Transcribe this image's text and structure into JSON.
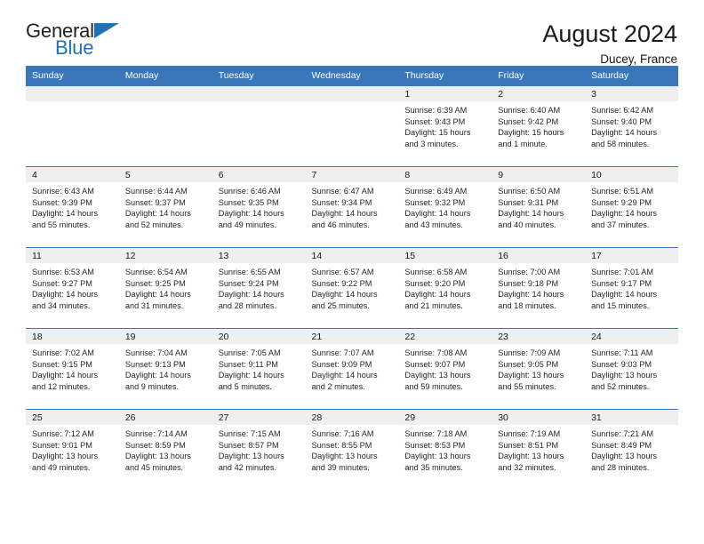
{
  "brand": {
    "name_part1": "General",
    "name_part2": "Blue",
    "triangle_color": "#1c72bb"
  },
  "header": {
    "title": "August 2024",
    "subtitle": "Ducey, France"
  },
  "colors": {
    "header_blue": "#3a76ba",
    "daynum_band": "#efefef",
    "text": "#1a1a1a"
  },
  "calendar": {
    "weekday_headers": [
      "Sunday",
      "Monday",
      "Tuesday",
      "Wednesday",
      "Thursday",
      "Friday",
      "Saturday"
    ],
    "labels": {
      "sunrise": "Sunrise:",
      "sunset": "Sunset:",
      "daylight": "Daylight:"
    },
    "weeks": [
      [
        {
          "day": "",
          "empty": true
        },
        {
          "day": "",
          "empty": true
        },
        {
          "day": "",
          "empty": true
        },
        {
          "day": "",
          "empty": true
        },
        {
          "day": "1",
          "sunrise": "Sunrise: 6:39 AM",
          "sunset": "Sunset: 9:43 PM",
          "daylight_1": "Daylight: 15 hours",
          "daylight_2": "and 3 minutes."
        },
        {
          "day": "2",
          "sunrise": "Sunrise: 6:40 AM",
          "sunset": "Sunset: 9:42 PM",
          "daylight_1": "Daylight: 15 hours",
          "daylight_2": "and 1 minute."
        },
        {
          "day": "3",
          "sunrise": "Sunrise: 6:42 AM",
          "sunset": "Sunset: 9:40 PM",
          "daylight_1": "Daylight: 14 hours",
          "daylight_2": "and 58 minutes."
        }
      ],
      [
        {
          "day": "4",
          "sunrise": "Sunrise: 6:43 AM",
          "sunset": "Sunset: 9:39 PM",
          "daylight_1": "Daylight: 14 hours",
          "daylight_2": "and 55 minutes."
        },
        {
          "day": "5",
          "sunrise": "Sunrise: 6:44 AM",
          "sunset": "Sunset: 9:37 PM",
          "daylight_1": "Daylight: 14 hours",
          "daylight_2": "and 52 minutes."
        },
        {
          "day": "6",
          "sunrise": "Sunrise: 6:46 AM",
          "sunset": "Sunset: 9:35 PM",
          "daylight_1": "Daylight: 14 hours",
          "daylight_2": "and 49 minutes."
        },
        {
          "day": "7",
          "sunrise": "Sunrise: 6:47 AM",
          "sunset": "Sunset: 9:34 PM",
          "daylight_1": "Daylight: 14 hours",
          "daylight_2": "and 46 minutes."
        },
        {
          "day": "8",
          "sunrise": "Sunrise: 6:49 AM",
          "sunset": "Sunset: 9:32 PM",
          "daylight_1": "Daylight: 14 hours",
          "daylight_2": "and 43 minutes."
        },
        {
          "day": "9",
          "sunrise": "Sunrise: 6:50 AM",
          "sunset": "Sunset: 9:31 PM",
          "daylight_1": "Daylight: 14 hours",
          "daylight_2": "and 40 minutes."
        },
        {
          "day": "10",
          "sunrise": "Sunrise: 6:51 AM",
          "sunset": "Sunset: 9:29 PM",
          "daylight_1": "Daylight: 14 hours",
          "daylight_2": "and 37 minutes."
        }
      ],
      [
        {
          "day": "11",
          "sunrise": "Sunrise: 6:53 AM",
          "sunset": "Sunset: 9:27 PM",
          "daylight_1": "Daylight: 14 hours",
          "daylight_2": "and 34 minutes."
        },
        {
          "day": "12",
          "sunrise": "Sunrise: 6:54 AM",
          "sunset": "Sunset: 9:25 PM",
          "daylight_1": "Daylight: 14 hours",
          "daylight_2": "and 31 minutes."
        },
        {
          "day": "13",
          "sunrise": "Sunrise: 6:55 AM",
          "sunset": "Sunset: 9:24 PM",
          "daylight_1": "Daylight: 14 hours",
          "daylight_2": "and 28 minutes."
        },
        {
          "day": "14",
          "sunrise": "Sunrise: 6:57 AM",
          "sunset": "Sunset: 9:22 PM",
          "daylight_1": "Daylight: 14 hours",
          "daylight_2": "and 25 minutes."
        },
        {
          "day": "15",
          "sunrise": "Sunrise: 6:58 AM",
          "sunset": "Sunset: 9:20 PM",
          "daylight_1": "Daylight: 14 hours",
          "daylight_2": "and 21 minutes."
        },
        {
          "day": "16",
          "sunrise": "Sunrise: 7:00 AM",
          "sunset": "Sunset: 9:18 PM",
          "daylight_1": "Daylight: 14 hours",
          "daylight_2": "and 18 minutes."
        },
        {
          "day": "17",
          "sunrise": "Sunrise: 7:01 AM",
          "sunset": "Sunset: 9:17 PM",
          "daylight_1": "Daylight: 14 hours",
          "daylight_2": "and 15 minutes."
        }
      ],
      [
        {
          "day": "18",
          "sunrise": "Sunrise: 7:02 AM",
          "sunset": "Sunset: 9:15 PM",
          "daylight_1": "Daylight: 14 hours",
          "daylight_2": "and 12 minutes."
        },
        {
          "day": "19",
          "sunrise": "Sunrise: 7:04 AM",
          "sunset": "Sunset: 9:13 PM",
          "daylight_1": "Daylight: 14 hours",
          "daylight_2": "and 9 minutes."
        },
        {
          "day": "20",
          "sunrise": "Sunrise: 7:05 AM",
          "sunset": "Sunset: 9:11 PM",
          "daylight_1": "Daylight: 14 hours",
          "daylight_2": "and 5 minutes."
        },
        {
          "day": "21",
          "sunrise": "Sunrise: 7:07 AM",
          "sunset": "Sunset: 9:09 PM",
          "daylight_1": "Daylight: 14 hours",
          "daylight_2": "and 2 minutes."
        },
        {
          "day": "22",
          "sunrise": "Sunrise: 7:08 AM",
          "sunset": "Sunset: 9:07 PM",
          "daylight_1": "Daylight: 13 hours",
          "daylight_2": "and 59 minutes."
        },
        {
          "day": "23",
          "sunrise": "Sunrise: 7:09 AM",
          "sunset": "Sunset: 9:05 PM",
          "daylight_1": "Daylight: 13 hours",
          "daylight_2": "and 55 minutes."
        },
        {
          "day": "24",
          "sunrise": "Sunrise: 7:11 AM",
          "sunset": "Sunset: 9:03 PM",
          "daylight_1": "Daylight: 13 hours",
          "daylight_2": "and 52 minutes."
        }
      ],
      [
        {
          "day": "25",
          "sunrise": "Sunrise: 7:12 AM",
          "sunset": "Sunset: 9:01 PM",
          "daylight_1": "Daylight: 13 hours",
          "daylight_2": "and 49 minutes."
        },
        {
          "day": "26",
          "sunrise": "Sunrise: 7:14 AM",
          "sunset": "Sunset: 8:59 PM",
          "daylight_1": "Daylight: 13 hours",
          "daylight_2": "and 45 minutes."
        },
        {
          "day": "27",
          "sunrise": "Sunrise: 7:15 AM",
          "sunset": "Sunset: 8:57 PM",
          "daylight_1": "Daylight: 13 hours",
          "daylight_2": "and 42 minutes."
        },
        {
          "day": "28",
          "sunrise": "Sunrise: 7:16 AM",
          "sunset": "Sunset: 8:55 PM",
          "daylight_1": "Daylight: 13 hours",
          "daylight_2": "and 39 minutes."
        },
        {
          "day": "29",
          "sunrise": "Sunrise: 7:18 AM",
          "sunset": "Sunset: 8:53 PM",
          "daylight_1": "Daylight: 13 hours",
          "daylight_2": "and 35 minutes."
        },
        {
          "day": "30",
          "sunrise": "Sunrise: 7:19 AM",
          "sunset": "Sunset: 8:51 PM",
          "daylight_1": "Daylight: 13 hours",
          "daylight_2": "and 32 minutes."
        },
        {
          "day": "31",
          "sunrise": "Sunrise: 7:21 AM",
          "sunset": "Sunset: 8:49 PM",
          "daylight_1": "Daylight: 13 hours",
          "daylight_2": "and 28 minutes."
        }
      ]
    ]
  }
}
